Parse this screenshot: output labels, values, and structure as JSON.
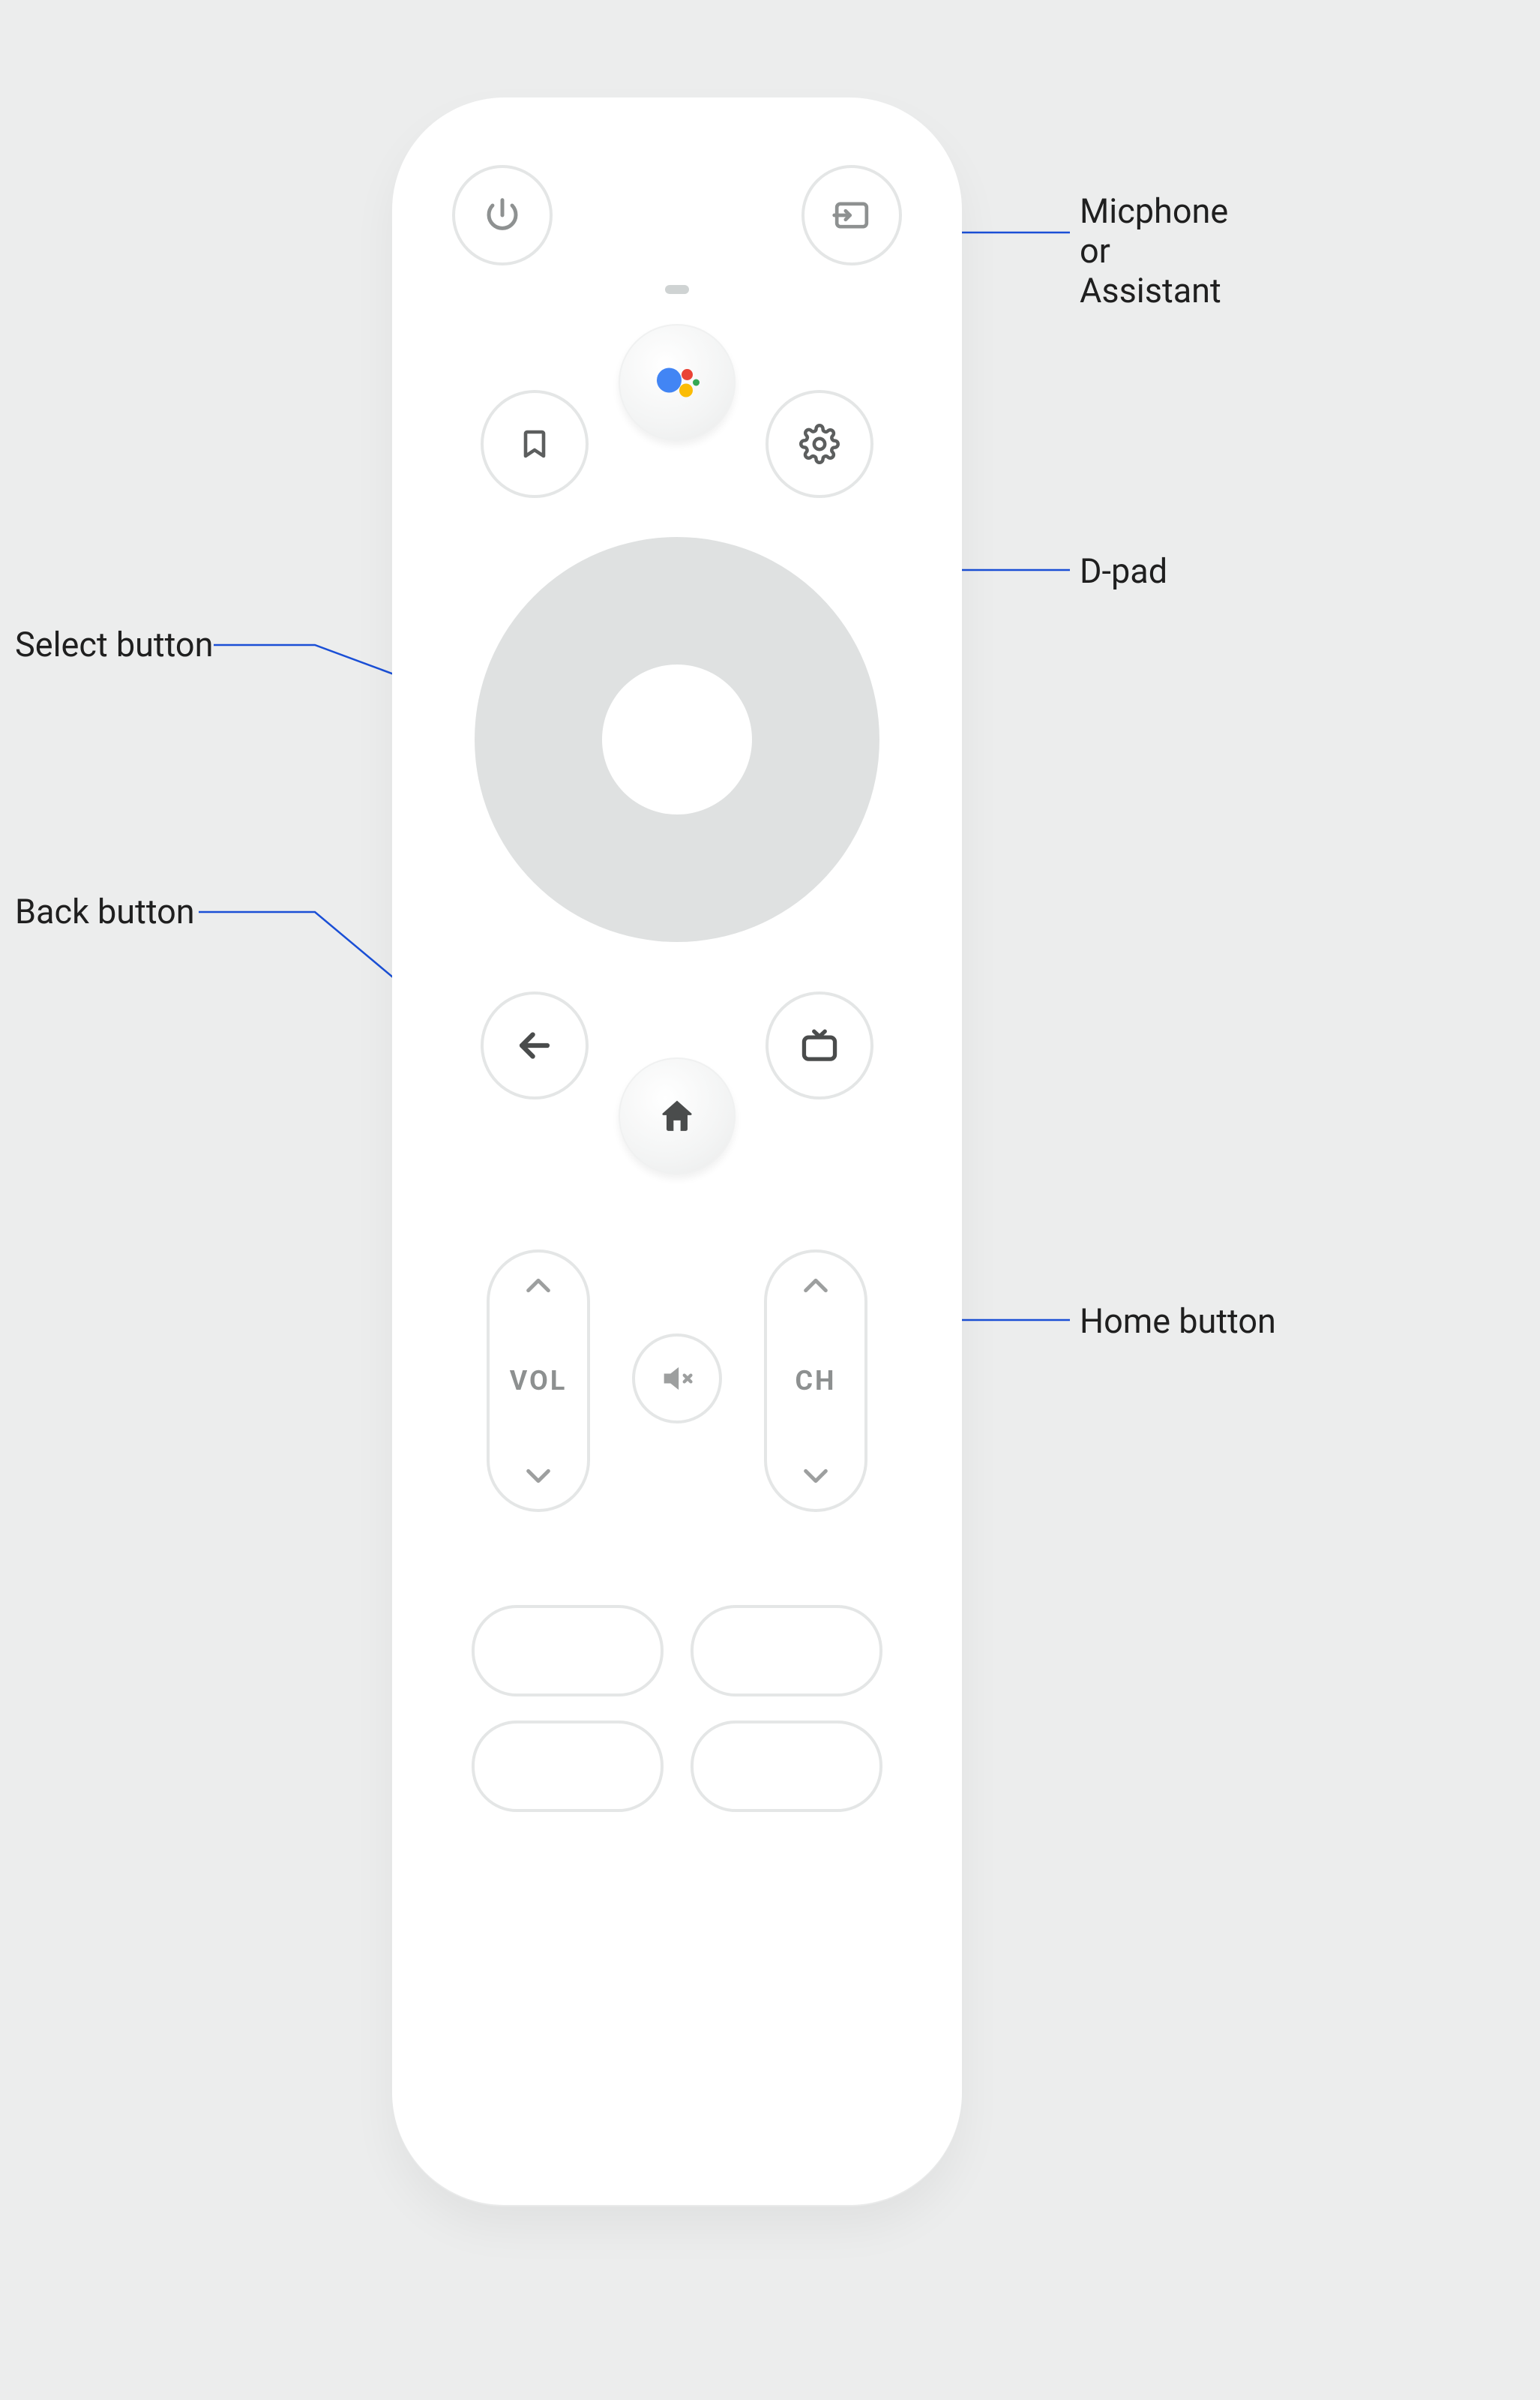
{
  "callouts": {
    "mic": "Micphone\nor\nAssistant",
    "dpad": "D-pad",
    "select": "Select button",
    "back": "Back button",
    "home": "Home button"
  },
  "rockers": {
    "volume_label": "VOL",
    "channel_label": "CH"
  },
  "icons": {
    "power": "power-icon",
    "input": "input-icon",
    "assistant": "assistant-icon",
    "bookmark": "bookmark-icon",
    "settings": "gear-icon",
    "back": "arrow-left-icon",
    "home": "home-icon",
    "guide": "tv-guide-icon",
    "mute": "mute-icon",
    "chevron_up": "chevron-up-icon",
    "chevron_down": "chevron-down-icon"
  },
  "colors": {
    "remote_body": "#ffffff",
    "background": "#eceded",
    "button_outline": "#e4e6e6",
    "dpad_fill": "#dfe1e1",
    "icon_grey": "#5c5e5e",
    "leader_blue": "#1a4fd6",
    "assistant_blue": "#4285f4",
    "assistant_red": "#ea4335",
    "assistant_yellow": "#fbbc05",
    "assistant_green": "#34a853"
  }
}
